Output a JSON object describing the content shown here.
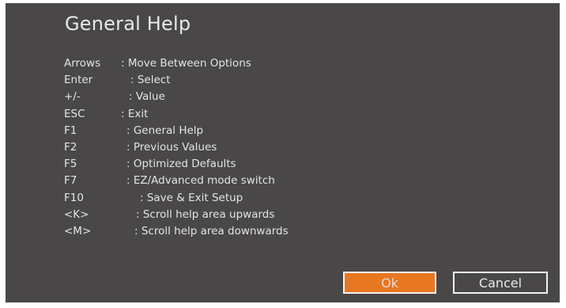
{
  "dialog": {
    "title": "General Help",
    "items": [
      {
        "key": "Arrows",
        "desc": ": Move Between Options"
      },
      {
        "key": "Enter",
        "desc": ": Select"
      },
      {
        "key": "+/-",
        "desc": ": Value"
      },
      {
        "key": "ESC",
        "desc": ": Exit"
      },
      {
        "key": "F1",
        "desc": ": General Help"
      },
      {
        "key": "F2",
        "desc": ": Previous Values"
      },
      {
        "key": "F5",
        "desc": ": Optimized Defaults"
      },
      {
        "key": "F7",
        "desc": ": EZ/Advanced mode switch"
      },
      {
        "key": "F10",
        "desc": ": Save & Exit Setup"
      },
      {
        "key": "<K>",
        "desc": ": Scroll help area upwards"
      },
      {
        "key": "<M>",
        "desc": ": Scroll help area downwards"
      }
    ],
    "buttons": {
      "ok_label": "Ok",
      "cancel_label": "Cancel"
    }
  },
  "colors": {
    "panel_background": "#4a4748",
    "accent": "#e87722",
    "text": "#e4e4e4",
    "button_border": "#f3f3f3"
  }
}
